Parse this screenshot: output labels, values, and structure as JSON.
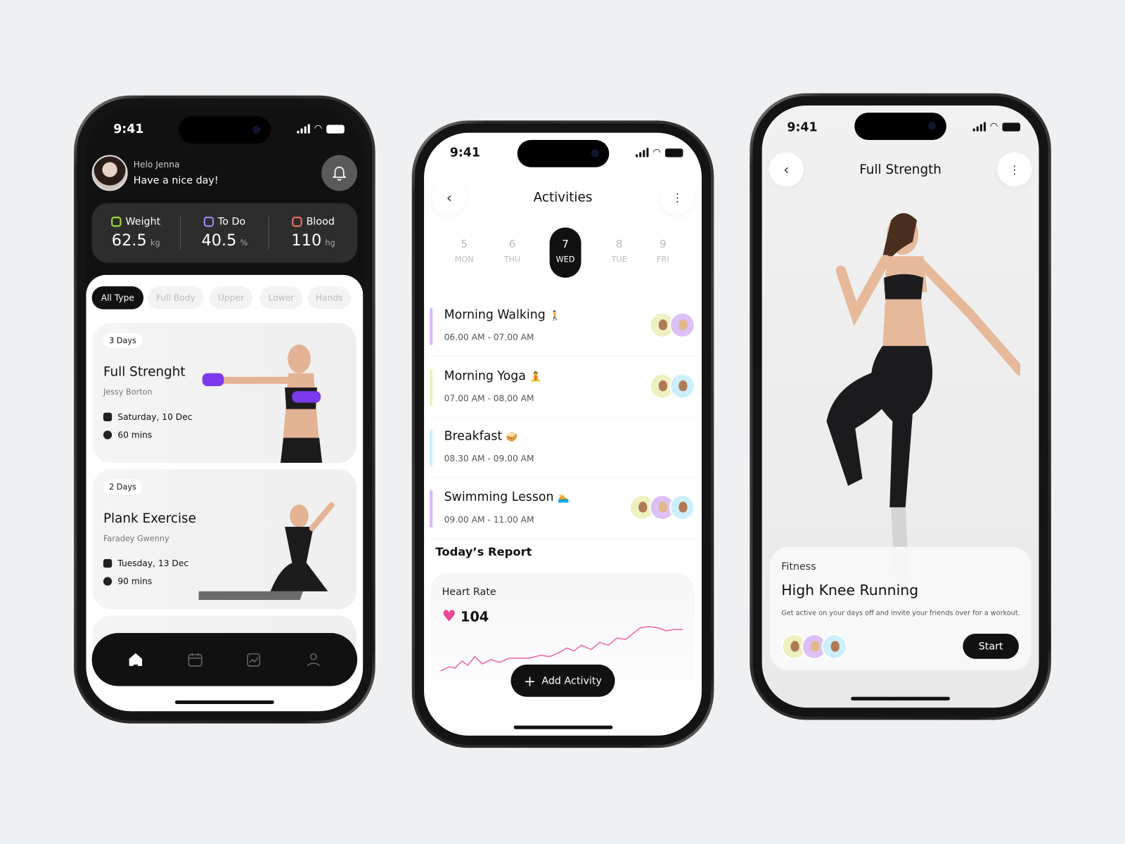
{
  "status_time": "9:41",
  "home": {
    "greeting": "Helo Jenna",
    "subtitle": "Have a nice day!",
    "stats": [
      {
        "label": "Weight",
        "value": "62.5",
        "unit": "kg",
        "color": "#a3e635"
      },
      {
        "label": "To Do",
        "value": "40.5",
        "unit": "%",
        "color": "#a78bfa"
      },
      {
        "label": "Blood",
        "value": "110",
        "unit": "hg",
        "color": "#f87171"
      }
    ],
    "filters": [
      "All Type",
      "Full Body",
      "Upper",
      "Lower",
      "Hands"
    ],
    "workouts": [
      {
        "badge": "3 Days",
        "title": "Full Strenght",
        "author": "Jessy Borton",
        "date": "Saturday, 10 Dec",
        "duration": "60 mins"
      },
      {
        "badge": "2 Days",
        "title": "Plank Exercise",
        "author": "Faradey Gwenny",
        "date": "Tuesday, 13 Dec",
        "duration": "90 mins"
      }
    ],
    "nav": [
      "home-icon",
      "calendar-icon",
      "chart-icon",
      "profile-icon"
    ]
  },
  "activities": {
    "title": "Activities",
    "days": [
      {
        "n": "5",
        "w": "MON"
      },
      {
        "n": "6",
        "w": "THU"
      },
      {
        "n": "7",
        "w": "WED",
        "selected": true
      },
      {
        "n": "8",
        "w": "TUE"
      },
      {
        "n": "9",
        "w": "FRI"
      }
    ],
    "items": [
      {
        "title": "Morning Walking",
        "emoji": "🚶",
        "time": "06.00 AM - 07.00 AM",
        "color": "#d8b8fb",
        "avatars": [
          "y",
          "p"
        ]
      },
      {
        "title": "Morning Yoga",
        "emoji": "🧘",
        "time": "07.00 AM - 08.00 AM",
        "color": "#eef0bf",
        "avatars": [
          "y",
          "b"
        ]
      },
      {
        "title": "Breakfast",
        "emoji": "🥪",
        "time": "08.30 AM - 09.00 AM",
        "color": "#cdeffc",
        "avatars": []
      },
      {
        "title": "Swimming Lesson",
        "emoji": "🏊",
        "time": "09.00 AM - 11.00 AM",
        "color": "#d8b8fb",
        "avatars": [
          "y",
          "p",
          "b"
        ]
      }
    ],
    "report_title": "Today’s Report",
    "heart_label": "Heart Rate",
    "heart_value": "104",
    "heart_color": "#ec4899",
    "add_label": "Add Activity"
  },
  "detail": {
    "title": "Full Strength",
    "category": "Fitness",
    "name": "High Knee Running",
    "description": "Get active on your days off and invite your friends over for a workout.",
    "start_label": "Start"
  }
}
